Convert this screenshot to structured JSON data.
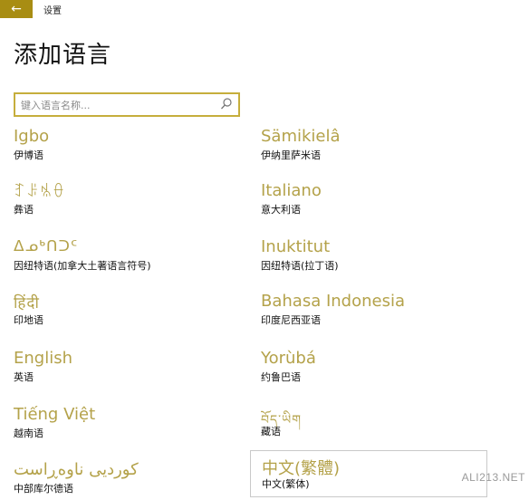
{
  "titlebar": {
    "back_symbol": "←",
    "title": "设置"
  },
  "page": {
    "title": "添加语言"
  },
  "search": {
    "placeholder": "键入语言名称...",
    "icon": "search-icon"
  },
  "languages": [
    {
      "native": "Igbo",
      "local": "伊博语"
    },
    {
      "native": "Sämikielâ",
      "local": "伊纳里萨米语"
    },
    {
      "native": "ꆈꌠꁱꂷ",
      "local": "彝语"
    },
    {
      "native": "Italiano",
      "local": "意大利语"
    },
    {
      "native": "ᐃᓄᒃᑎᑐᑦ",
      "local": "因纽特语(加拿大土著语言符号)"
    },
    {
      "native": "Inuktitut",
      "local": "因纽特语(拉丁语)"
    },
    {
      "native": "हिंदी",
      "local": "印地语"
    },
    {
      "native": "Bahasa Indonesia",
      "local": "印度尼西亚语"
    },
    {
      "native": "English",
      "local": "英语"
    },
    {
      "native": "Yorùbá",
      "local": "约鲁巴语"
    },
    {
      "native": "Tiếng Việt",
      "local": "越南语"
    },
    {
      "native": "བོད་ཡིག",
      "local": "藏语"
    },
    {
      "native": "کوردیی ناوەڕاست",
      "local": "中部库尔德语"
    },
    {
      "native": "中文(繁體)",
      "local": "中文(繁体)"
    }
  ],
  "watermark": "ALI213.NET",
  "colors": {
    "accent": "#a88d13",
    "native_text": "#b4a24a",
    "search_border": "#c6ae3c"
  }
}
